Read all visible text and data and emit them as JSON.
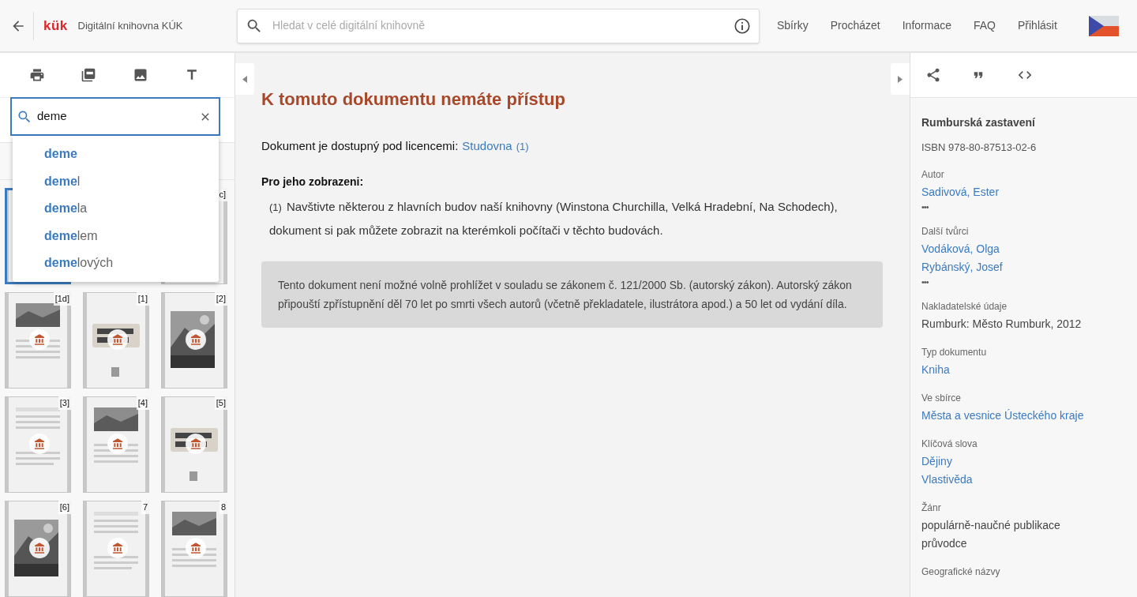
{
  "header": {
    "logo": "kük",
    "title": "Digitální knihovna KÚK",
    "search_placeholder": "Hledat v celé digitální knihovně",
    "nav": [
      "Sbírky",
      "Procházet",
      "Informace",
      "FAQ",
      "Přihlásit"
    ]
  },
  "left_panel": {
    "search": {
      "value": "deme"
    },
    "suggestions": [
      {
        "match": "deme"
      },
      {
        "match": "deme",
        "rest": "l"
      },
      {
        "match": "deme",
        "rest": "la"
      },
      {
        "match": "deme",
        "rest": "lem"
      },
      {
        "match": "deme",
        "rest": "lových"
      }
    ],
    "thumbnails": [
      {
        "selected": true
      },
      {
        "label": "c]",
        "selected": false
      },
      {
        "label": "[1d]",
        "selected": false
      },
      {
        "label": "[1]",
        "selected": false
      },
      {
        "label": "[2]",
        "selected": false
      },
      {
        "label": "[3]",
        "selected": false
      },
      {
        "label": "[4]",
        "selected": false
      },
      {
        "label": "[5]",
        "selected": false
      },
      {
        "label": "[6]",
        "selected": false
      },
      {
        "label": "7",
        "selected": false
      },
      {
        "label": "8",
        "selected": false
      }
    ]
  },
  "content": {
    "heading": "K tomuto dokumentu nemáte přístup",
    "license_text": "Dokument je dostupný pod licencemi:",
    "license_link": "Studovna",
    "license_note": "(1)",
    "instructions_title": "Pro jeho zobrazeni:",
    "instructions": [
      {
        "marker": "(1)",
        "text": "Navštivte některou z hlavních budov naší knihovny (Winstona Churchilla, Velká Hradební, Na Schodech), dokument si pak můžete zobrazit na kterémkoli počítači v těchto budovách."
      }
    ],
    "notice": "Tento dokument není možné volně prohlížet v souladu se zákonem č. 121/2000 Sb. (autorský zákon). Autorský zákon připouští zpřístupnění děl 70 let po smrti všech autorů (včetně překladatele, ilustrátora apod.) a 50 let od vydání díla."
  },
  "metadata": {
    "title": "Rumburská zastavení",
    "isbn": "ISBN 978-80-87513-02-6",
    "fields": [
      {
        "label": "Autor",
        "values": [
          {
            "text": "Sadivová, Ester",
            "link": true
          }
        ],
        "more": "•••"
      },
      {
        "label": "Další tvůrci",
        "values": [
          {
            "text": "Vodáková, Olga",
            "link": true
          },
          {
            "text": "Rybánský, Josef",
            "link": true
          }
        ],
        "more": "•••"
      },
      {
        "label": "Nakladatelské údaje",
        "values": [
          {
            "text": "Rumburk: Město Rumburk, 2012",
            "link": false
          }
        ]
      },
      {
        "label": "Typ dokumentu",
        "values": [
          {
            "text": "Kniha",
            "link": true
          }
        ]
      },
      {
        "label": "Ve sbírce",
        "values": [
          {
            "text": "Města a vesnice Ústeckého kraje",
            "link": true
          }
        ]
      },
      {
        "label": "Klíčová slova",
        "values": [
          {
            "text": "Dějiny",
            "link": true
          },
          {
            "text": "Vlastivěda",
            "link": true
          }
        ]
      },
      {
        "label": "Žánr",
        "values": [
          {
            "text": "populárně-naučné publikace",
            "link": false
          },
          {
            "text": "průvodce",
            "link": false
          }
        ]
      },
      {
        "label": "Geografické názvy"
      }
    ]
  }
}
